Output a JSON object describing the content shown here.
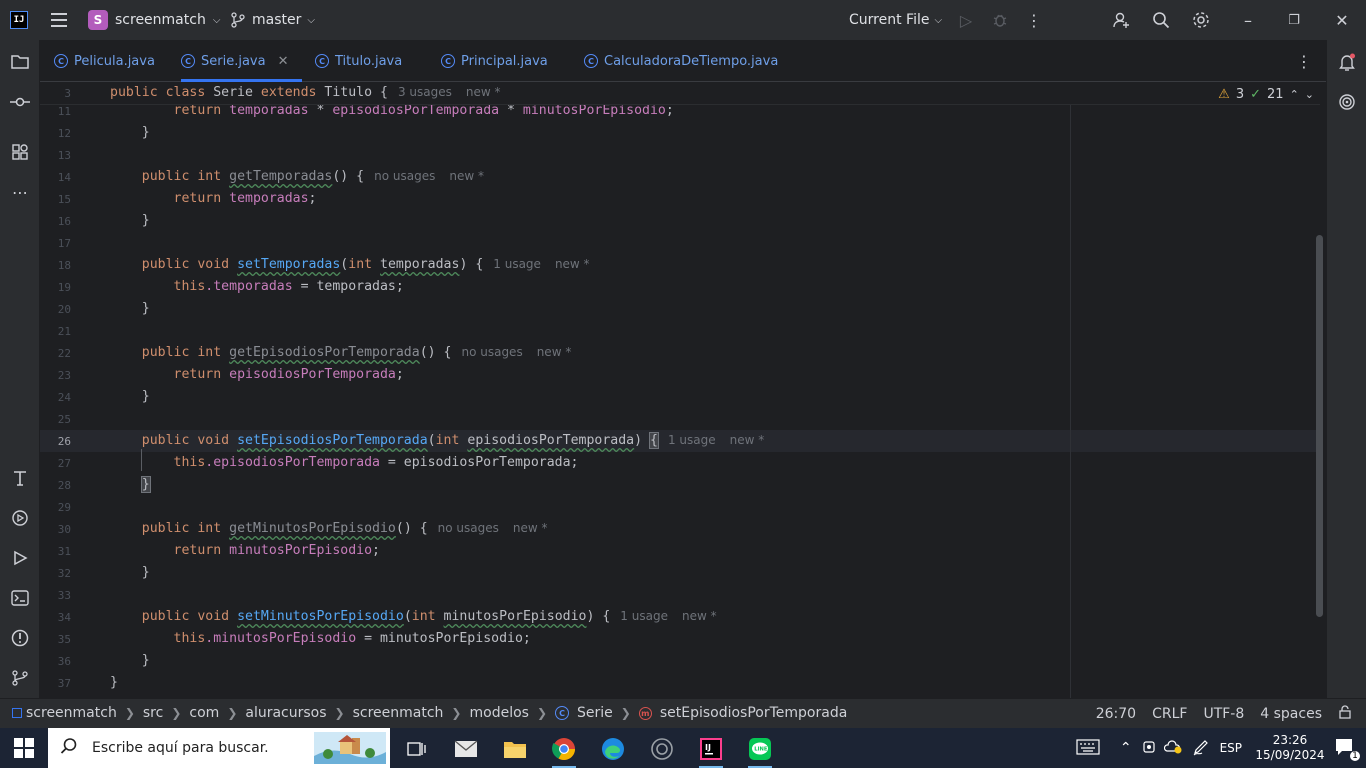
{
  "titlebar": {
    "project_initial": "S",
    "project_name": "screenmatch",
    "branch": "master",
    "run_config": "Current File"
  },
  "tabs": [
    {
      "label": "Pelicula.java"
    },
    {
      "label": "Serie.java",
      "active": true
    },
    {
      "label": "Titulo.java"
    },
    {
      "label": "Principal.java"
    },
    {
      "label": "CalculadoraDeTiempo.java"
    }
  ],
  "inspections": {
    "warnings": "3",
    "ok": "21"
  },
  "editor": {
    "sticky": {
      "line": "3",
      "text_prefix": "public class ",
      "class_name": "Serie",
      "extends": "extends",
      "parent": "Titulo",
      "brace": " {",
      "hint_usages": "3 usages",
      "hint_new": "new *"
    },
    "line_numbers": [
      "11",
      "12",
      "13",
      "14",
      "15",
      "16",
      "17",
      "18",
      "19",
      "20",
      "21",
      "22",
      "23",
      "24",
      "25",
      "26",
      "27",
      "28",
      "29",
      "30",
      "31",
      "32",
      "33",
      "34",
      "35",
      "36",
      "37"
    ],
    "hints": {
      "no_usages": "no usages",
      "one_usage": "1 usage",
      "new": "new *"
    },
    "lines": {
      "l11": {
        "kw": "return",
        "a": "temporadas",
        "op1": " * ",
        "b": "episodiosPorTemporada",
        "op2": " * ",
        "c": "minutosPorEpisodio",
        "end": ";"
      },
      "l14": {
        "kw1": "public",
        "kw2": "int",
        "name": "getTemporadas",
        "rest": "() {"
      },
      "l15": {
        "kw": "return",
        "field": "temporadas",
        "end": ";"
      },
      "l18": {
        "kw1": "public",
        "kw2": "void",
        "name": "setTemporadas",
        "open": "(",
        "ptype": "int",
        "param": "temporadas",
        "rest": ") {"
      },
      "l19": {
        "kw": "this",
        "field": ".temporadas",
        "rest": " = temporadas;"
      },
      "l22": {
        "kw1": "public",
        "kw2": "int",
        "name": "getEpisodiosPorTemporada",
        "rest": "() {"
      },
      "l23": {
        "kw": "return",
        "field": "episodiosPorTemporada",
        "end": ";"
      },
      "l26": {
        "kw1": "public",
        "kw2": "void",
        "name": "setEpisodiosPorTemporada",
        "open": "(",
        "ptype": "int",
        "param": "episodiosPorTemporada",
        "rest": ") ",
        "brace": "{"
      },
      "l27": {
        "kw": "this",
        "field": ".episodiosPorTemporada",
        "rest": " = episodiosPorTemporada;"
      },
      "l30": {
        "kw1": "public",
        "kw2": "int",
        "name": "getMinutosPorEpisodio",
        "rest": "() {"
      },
      "l31": {
        "kw": "return",
        "field": "minutosPorEpisodio",
        "end": ";"
      },
      "l34": {
        "kw1": "public",
        "kw2": "void",
        "name": "setMinutosPorEpisodio",
        "open": "(",
        "ptype": "int",
        "param": "minutosPorEpisodio",
        "rest": ") {"
      },
      "l35": {
        "kw": "this",
        "field": ".minutosPorEpisodio",
        "rest": " = minutosPorEpisodio;"
      },
      "close": "}"
    }
  },
  "breadcrumbs": [
    "screenmatch",
    "src",
    "com",
    "aluracursos",
    "screenmatch",
    "modelos",
    "Serie",
    "setEpisodiosPorTemporada"
  ],
  "status": {
    "position": "26:70",
    "line_sep": "CRLF",
    "encoding": "UTF-8",
    "indent": "4 spaces"
  },
  "taskbar": {
    "search_placeholder": "Escribe aquí para buscar.",
    "language": "ESP",
    "time": "23:26",
    "date": "15/09/2024",
    "notifications": "1"
  },
  "colors": {
    "accent": "#3574f0",
    "keyword": "#cf8e6d",
    "field": "#c77dbb",
    "method": "#56a8f5",
    "warning": "#e5a83b"
  }
}
